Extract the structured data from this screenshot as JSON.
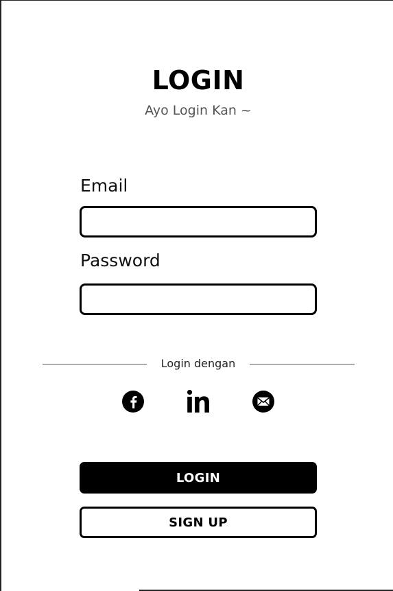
{
  "header": {
    "title": "LOGIN",
    "subtitle": "Ayo Login Kan ~"
  },
  "form": {
    "email_label": "Email",
    "email_value": "",
    "email_placeholder": "",
    "password_label": "Password",
    "password_value": "",
    "password_placeholder": ""
  },
  "social": {
    "divider_label": "Login dengan",
    "icons": [
      "facebook-icon",
      "linkedin-icon",
      "mail-icon"
    ]
  },
  "actions": {
    "login_label": "LOGIN",
    "signup_label": "SIGN UP"
  },
  "colors": {
    "primary": "#000000",
    "background": "#ffffff",
    "subtitle": "#555555"
  }
}
